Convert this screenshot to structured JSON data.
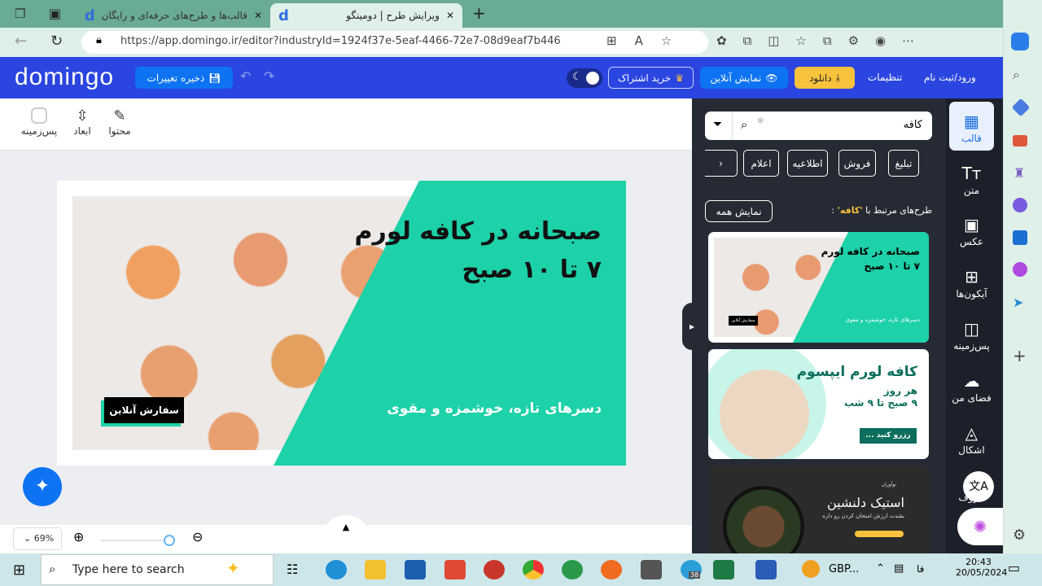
{
  "browser": {
    "tabs": [
      {
        "title": "قالب‌ها و طرح‌های حرفه‌ای و رایگان"
      },
      {
        "title": "ویرایش طرح | دومینگو"
      }
    ],
    "url": "https://app.domingo.ir/editor?industryId=1924f37e-5eaf-4466-72e7-08d9eaf7b446"
  },
  "header": {
    "logo": "domingo",
    "save_label": "ذخیره تغییرات",
    "subscribe_label": "خرید اشتراک",
    "preview_label": "نمایش آنلاین",
    "download_label": "دانلود",
    "settings_label": "تنظیمات",
    "login_label": "ورود/ثبت نام",
    "accent": "#2a45e0",
    "download_color": "#f9c23c"
  },
  "toolbar": {
    "items": [
      {
        "label": "محتوا",
        "icon": "pencil-icon"
      },
      {
        "label": "ابعاد",
        "icon": "resize-icon"
      },
      {
        "label": "پس‌زمینه",
        "icon": "background-icon"
      }
    ]
  },
  "design": {
    "headline1": "صبحانه در کافه لورم",
    "headline2": "۷ تا ۱۰ صبح",
    "subtitle": "دسرهای تازه، خوشمزه و مقوی",
    "cta": "سفارش آنلاین",
    "teal": "#1dd1a8"
  },
  "zoom": {
    "level": "69%"
  },
  "panel": {
    "search_value": "کافه",
    "chips": [
      "تبلیغ",
      "فروش",
      "اطلاعیه",
      "اعلام"
    ],
    "related_prefix": "طرح‌های مرتبط با",
    "related_term": "'کافه'",
    "related_suffix": ":",
    "show_all": "نمایش همه",
    "cards": [
      {
        "headline1": "صبحانه در کافه لورم",
        "headline2": "۷ تا ۱۰ صبح",
        "subtitle": "دسرهای تازه، خوشمزه و مقوی",
        "cta": "سفارش آنلاین"
      },
      {
        "title": "کافه لورم ایپسوم",
        "line1": "هر روز",
        "line2": "۹ صبح تا ۹ شب",
        "cta": "رزرو کنید ..."
      },
      {
        "brand": "نوآوران",
        "title": "استیک دلنشین",
        "subtitle": "بشدت ارزش امتحان کردن رو داره"
      }
    ]
  },
  "rail": {
    "items": [
      "قالب",
      "متن",
      "عکس",
      "آیکون‌ها",
      "پس‌زمینه",
      "فضای من",
      "اشکال",
      "حروف"
    ]
  },
  "taskbar": {
    "search_placeholder": "Type here to search",
    "gbp": "GBP...",
    "lang": "فا",
    "time": "20:43",
    "date": "20/05/2024",
    "telegram_badge": "38"
  }
}
